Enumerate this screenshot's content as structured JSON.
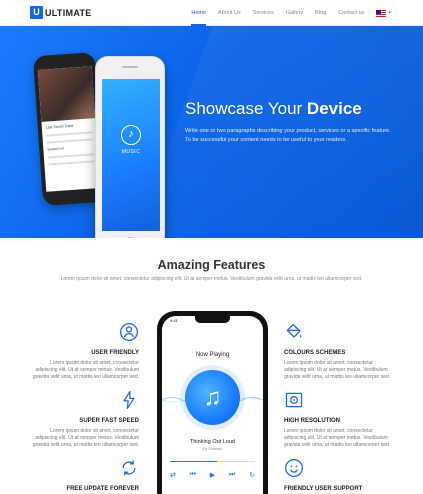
{
  "header": {
    "logo_mark": "U",
    "logo_text": "ULTIMATE",
    "nav": [
      "Home",
      "About Us",
      "Services",
      "Gallery",
      "Blog",
      "Contact us"
    ],
    "active_index": 0,
    "caret": "▾"
  },
  "hero": {
    "title_prefix": "Showcase Your ",
    "title_bold": "Device",
    "text_line1": "Write one or two paragraphs describing your product, services or a specific feature.",
    "text_line2": "To be successful your content needs to be useful to your readers.",
    "back_phone_title": "Last Sound Trace",
    "back_phone_sub": "Sound List",
    "front_phone_label": "MUSIC"
  },
  "features": {
    "title": "Amazing Features",
    "subtitle": "Lorem ipsum dolor sit amet, consectetur adipiscing elit. Ut at semper metus. Vestibulum gravida velit urna, ut mattis leo ullamcorper sed.",
    "desc": "Lorem ipsum dolor sit amet, consectetur adipiscing elit. Ut at semper metus. Vestibulum gravida velit urna, ut mattis leo ullamcorper sed.",
    "left": [
      {
        "name": "USER FRIENDLY",
        "icon": "user-icon"
      },
      {
        "name": "SUPER FAST SPEED",
        "icon": "bolt-icon"
      },
      {
        "name": "FREE UPDATE FOREVER",
        "icon": "refresh-icon"
      }
    ],
    "right": [
      {
        "name": "COLOURS SCHEMES",
        "icon": "paint-bucket-icon"
      },
      {
        "name": "HIGH RESOLUTION",
        "icon": "safe-icon"
      },
      {
        "name": "FRIENDLY USER SUPPORT",
        "icon": "smiley-icon"
      }
    ]
  },
  "player": {
    "time": "9:41",
    "now_playing": "Now Playing",
    "song": "Thinking Out Loud",
    "artist": "Ed Sheeran",
    "progress": 0.55,
    "accent": "#1a7cff"
  }
}
